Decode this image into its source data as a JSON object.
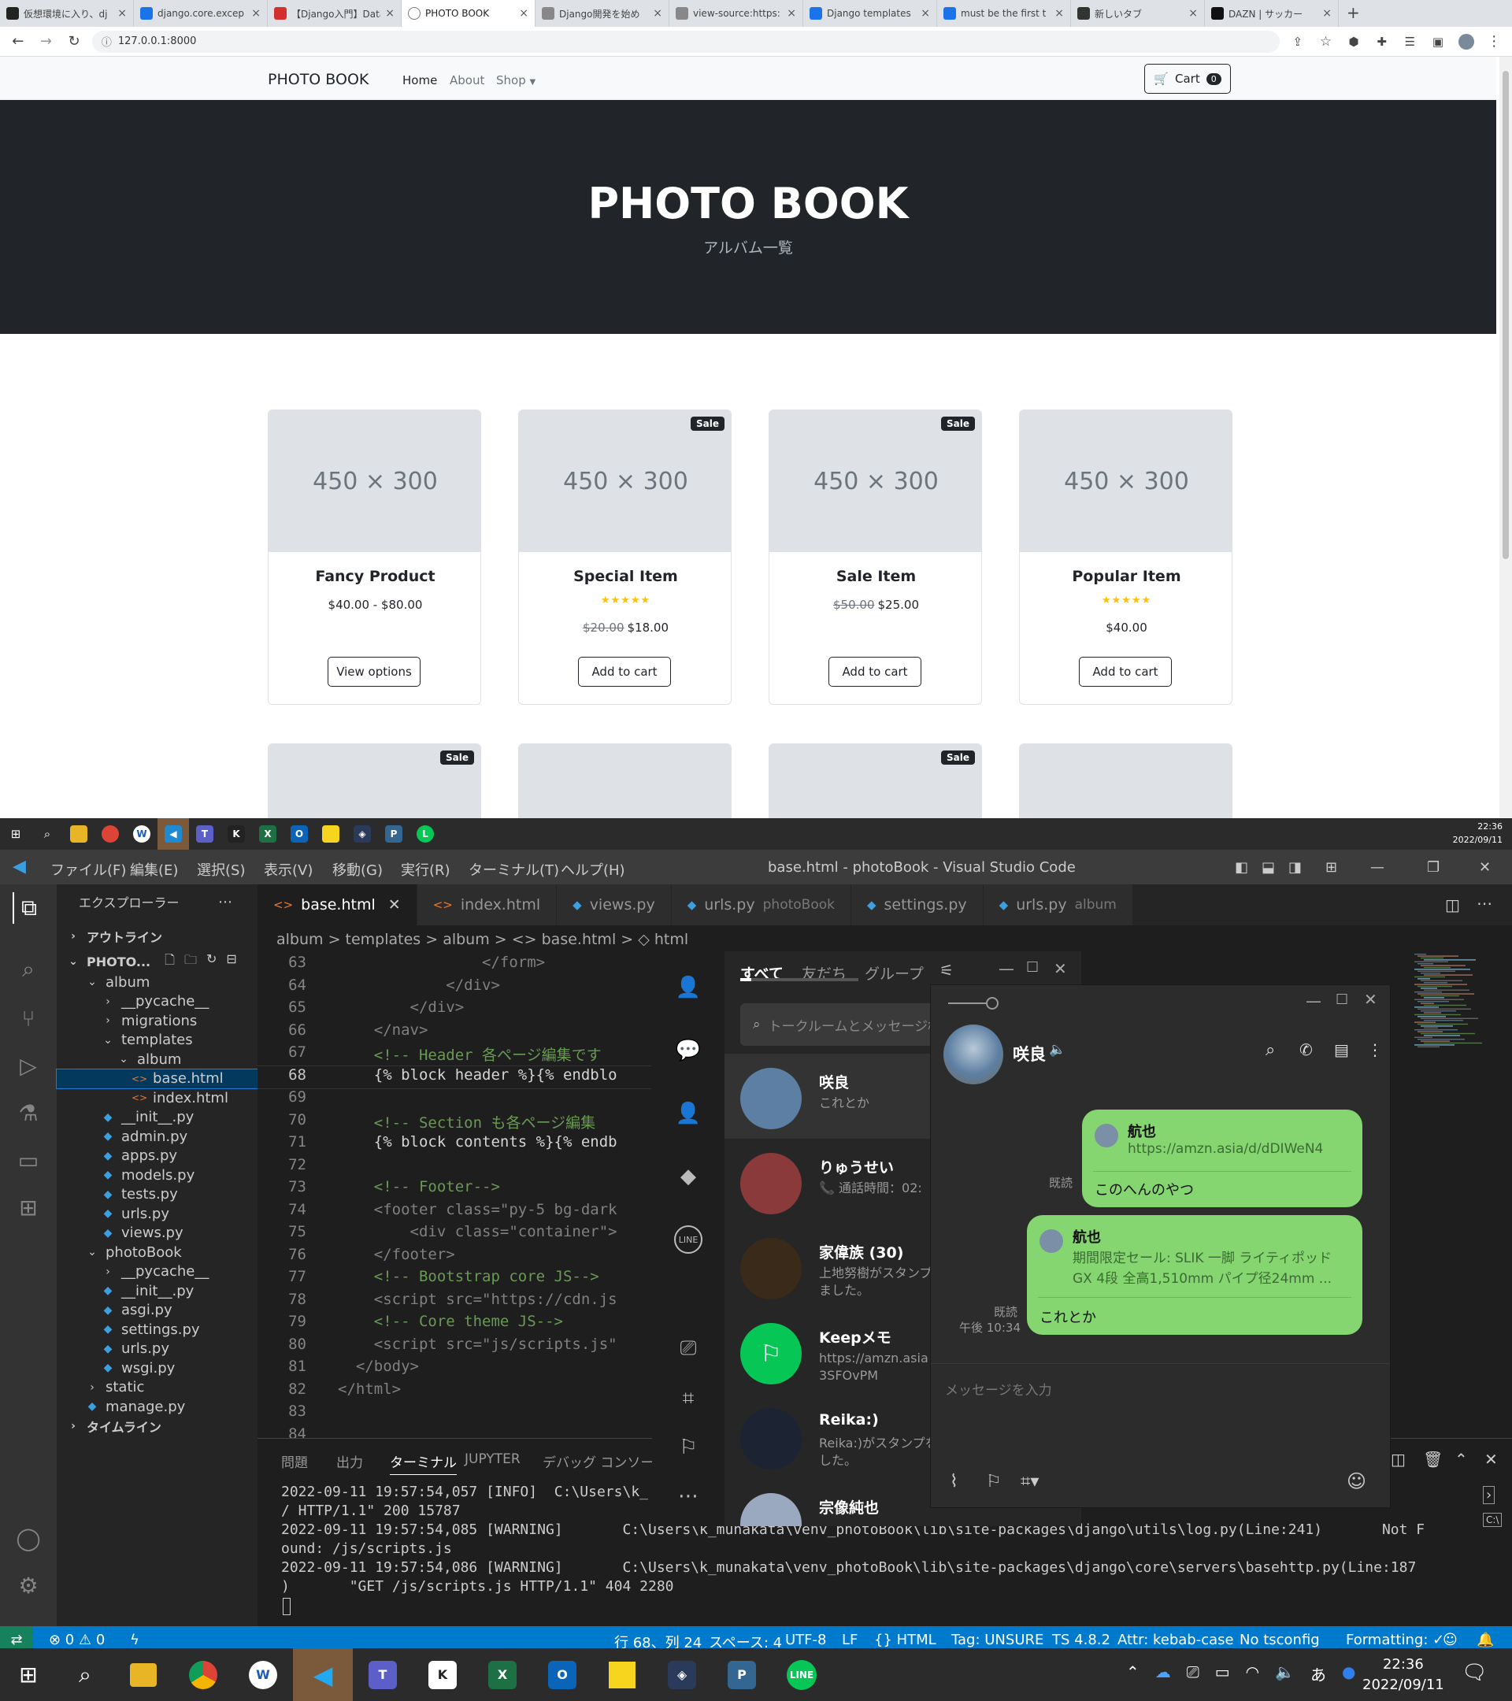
{
  "browser": {
    "tabs": [
      "仮想環境に入り、dj",
      "django.core.excep",
      "【Django入門】Data",
      "PHOTO BOOK",
      "Django開発を始め",
      "view-source:https:",
      "Django templates",
      "must be the first t",
      "新しいタブ",
      "DAZN | サッカー"
    ],
    "url": "127.0.0.1:8000",
    "site": {
      "brand": "PHOTO BOOK",
      "nav": [
        "Home",
        "About",
        "Shop"
      ],
      "cart_label": "Cart",
      "cart_count": "0",
      "hero_title": "PHOTO BOOK",
      "hero_subtitle": "アルバム一覧",
      "placeholder": "450 × 300",
      "sale_label": "Sale",
      "stars": "★★★★★",
      "products": [
        {
          "name": "Fancy Product",
          "price": "$40.00 - $80.00",
          "old": "",
          "button": "View options",
          "sale": false,
          "rated": false
        },
        {
          "name": "Special Item",
          "price": "$18.00",
          "old": "$20.00",
          "button": "Add to cart",
          "sale": true,
          "rated": true
        },
        {
          "name": "Sale Item",
          "price": "$25.00",
          "old": "$50.00",
          "button": "Add to cart",
          "sale": true,
          "rated": false
        },
        {
          "name": "Popular Item",
          "price": "$40.00",
          "old": "",
          "button": "Add to cart",
          "sale": false,
          "rated": true
        }
      ],
      "row2_sale": [
        true,
        false,
        true,
        false
      ]
    }
  },
  "taskbar": {
    "time": "22:36",
    "date": "2022/09/11",
    "ime": "あ"
  },
  "vscode": {
    "menu": [
      "ファイル(F)",
      "編集(E)",
      "選択(S)",
      "表示(V)",
      "移動(G)",
      "実行(R)",
      "ターミナル(T)",
      "ヘルプ(H)"
    ],
    "title": "base.html - photoBook - Visual Studio Code",
    "explorer_title": "エクスプローラー",
    "outline": "アウトライン",
    "project": "PHOTO...",
    "timeline": "タイムライン",
    "tree": [
      {
        "label": "album",
        "depth": 1,
        "kind": "folder-open"
      },
      {
        "label": "__pycache__",
        "depth": 2,
        "kind": "folder"
      },
      {
        "label": "migrations",
        "depth": 2,
        "kind": "folder"
      },
      {
        "label": "templates",
        "depth": 2,
        "kind": "folder-open"
      },
      {
        "label": "album",
        "depth": 3,
        "kind": "folder-open"
      },
      {
        "label": "base.html",
        "depth": 4,
        "kind": "html",
        "selected": true
      },
      {
        "label": "index.html",
        "depth": 4,
        "kind": "html"
      },
      {
        "label": "__init__.py",
        "depth": 2,
        "kind": "py"
      },
      {
        "label": "admin.py",
        "depth": 2,
        "kind": "py"
      },
      {
        "label": "apps.py",
        "depth": 2,
        "kind": "py"
      },
      {
        "label": "models.py",
        "depth": 2,
        "kind": "py"
      },
      {
        "label": "tests.py",
        "depth": 2,
        "kind": "py"
      },
      {
        "label": "urls.py",
        "depth": 2,
        "kind": "py"
      },
      {
        "label": "views.py",
        "depth": 2,
        "kind": "py"
      },
      {
        "label": "photoBook",
        "depth": 1,
        "kind": "folder-open"
      },
      {
        "label": "__pycache__",
        "depth": 2,
        "kind": "folder"
      },
      {
        "label": "__init__.py",
        "depth": 2,
        "kind": "py"
      },
      {
        "label": "asgi.py",
        "depth": 2,
        "kind": "py"
      },
      {
        "label": "settings.py",
        "depth": 2,
        "kind": "py"
      },
      {
        "label": "urls.py",
        "depth": 2,
        "kind": "py"
      },
      {
        "label": "wsgi.py",
        "depth": 2,
        "kind": "py"
      },
      {
        "label": "static",
        "depth": 1,
        "kind": "folder"
      },
      {
        "label": "manage.py",
        "depth": 1,
        "kind": "py"
      }
    ],
    "tabs": [
      {
        "label": "base.html",
        "dim": "",
        "kind": "html",
        "active": true
      },
      {
        "label": "index.html",
        "dim": "",
        "kind": "html"
      },
      {
        "label": "views.py",
        "dim": "",
        "kind": "py"
      },
      {
        "label": "urls.py",
        "dim": "photoBook",
        "kind": "py"
      },
      {
        "label": "settings.py",
        "dim": "",
        "kind": "py"
      },
      {
        "label": "urls.py",
        "dim": "album",
        "kind": "py"
      }
    ],
    "breadcrumb": "album > templates > album > <> base.html > ◇ html",
    "code": [
      {
        "n": "63",
        "t": "                </form>"
      },
      {
        "n": "64",
        "t": "            </div>"
      },
      {
        "n": "65",
        "t": "        </div>"
      },
      {
        "n": "66",
        "t": "    </nav>"
      },
      {
        "n": "67",
        "t": "    <!-- Header 各ページ編集です"
      },
      {
        "n": "68",
        "t": "    {% block header %}{% endblo"
      },
      {
        "n": "69",
        "t": ""
      },
      {
        "n": "70",
        "t": "    <!-- Section も各ページ編集"
      },
      {
        "n": "71",
        "t": "    {% block contents %}{% endb"
      },
      {
        "n": "72",
        "t": ""
      },
      {
        "n": "73",
        "t": "    <!-- Footer-->"
      },
      {
        "n": "74",
        "t": "    <footer class=\"py-5 bg-dark"
      },
      {
        "n": "75",
        "t": "        <div class=\"container\">"
      },
      {
        "n": "76",
        "t": "    </footer>"
      },
      {
        "n": "77",
        "t": "    <!-- Bootstrap core JS-->"
      },
      {
        "n": "78",
        "t": "    <script src=\"https://cdn.js"
      },
      {
        "n": "79",
        "t": "    <!-- Core theme JS-->"
      },
      {
        "n": "80",
        "t": "    <script src=\"js/scripts.js\""
      },
      {
        "n": "81",
        "t": "  </body>"
      },
      {
        "n": "82",
        "t": "</html>"
      },
      {
        "n": "83",
        "t": ""
      },
      {
        "n": "84",
        "t": ""
      }
    ],
    "panel_tabs": [
      "問題",
      "出力",
      "ターミナル",
      "JUPYTER",
      "デバッグ コンソール"
    ],
    "terminal": "2022-09-11 19:57:54,057 [INFO]  C:\\Users\\k_                                                    \"GET\n/ HTTP/1.1\" 200 15787\n2022-09-11 19:57:54,085 [WARNING]       C:\\Users\\k_munakata\\venv_photoBook\\lib\\site-packages\\django\\utils\\log.py(Line:241)       Not F\nound: /js/scripts.js\n2022-09-11 19:57:54,086 [WARNING]       C:\\Users\\k_munakata\\venv_photoBook\\lib\\site-packages\\django\\core\\servers\\basehttp.py(Line:187\n)       \"GET /js/scripts.js HTTP/1.1\" 404 2280",
    "status": {
      "errors": "⊗ 0 ⚠ 0",
      "position": "行 68、列 24",
      "spaces": "スペース: 4",
      "encoding": "UTF-8",
      "eol": "LF",
      "lang": "{} HTML",
      "tag": "Tag: UNSURE",
      "ts": "TS 4.8.2",
      "attr": "Attr: kebab-case",
      "tsconfig": "No tsconfig",
      "formatting": "Formatting: ✓"
    }
  },
  "line": {
    "tabs": [
      "すべて",
      "友だち",
      "グループ"
    ],
    "search_placeholder": "トークルームとメッセージ検",
    "chats": [
      {
        "name": "咲良",
        "msg": "これとか",
        "color": "#5d7fa3"
      },
      {
        "name": "りゅうせい",
        "msg": "📞 通話時間：02:",
        "color": "#8a3a3a"
      },
      {
        "name": "家偉族 (30)",
        "msg": "上地努樹がスタンプ\nました。",
        "color": "#3a2a1a"
      },
      {
        "name": "Keepメモ",
        "msg": "https://amzn.asia\n3SFOvPM",
        "color": "#06c755"
      },
      {
        "name": "Reika:)",
        "msg": "Reika:)がスタンプを\nした。",
        "color": "#1c2434"
      },
      {
        "name": "宗像純也",
        "msg": "",
        "color": "#9aa8c0"
      }
    ],
    "chat": {
      "name": "咲良",
      "msg1": {
        "sender": "航也",
        "link": "https://amzn.asia/d/dDIWeN4",
        "text": "このへんのやつ",
        "read": "既読"
      },
      "msg2": {
        "sender": "航也",
        "preview1": "期間限定セール: SLIK 一脚 ライティポッド",
        "preview2": "GX 4段 全高1,510mm パイプ径24mm ...",
        "text": "これとか",
        "read": "既読",
        "time": "午後 10:34"
      },
      "input_placeholder": "メッセージを入力"
    }
  }
}
